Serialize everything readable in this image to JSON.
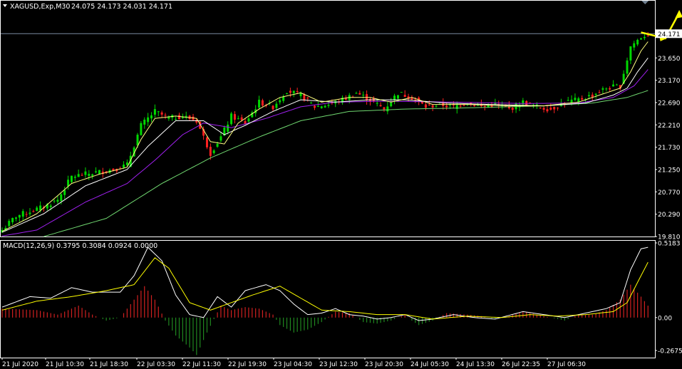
{
  "header": {
    "symbol": "XAGUSD,Exp,M30",
    "ohlc": "24.075 24.173 24.031 24.171"
  },
  "macd_header": "MACD(12,26,9) 0.3795 0.3084 0.0924 0.0000",
  "colors": {
    "background": "#000000",
    "frame": "#ffffff",
    "bull_candle": "#00d800",
    "bear_candle": "#ff2020",
    "ma_fast": "#ffff80",
    "ma_mid": "#ffffff",
    "ma_slow": "#a020f0",
    "ma_long": "#70d870",
    "macd_line": "#ffffff",
    "signal_line": "#ffff00",
    "hist_pos": "#d02020",
    "hist_neg": "#208820",
    "arrow": "#ffff00"
  },
  "chart_data": [
    {
      "type": "candlestick",
      "panel": "price",
      "ylim": [
        19.81,
        24.62
      ],
      "y_ticks": [
        "24.171",
        "23.650",
        "23.170",
        "22.690",
        "22.210",
        "21.730",
        "21.250",
        "20.770",
        "20.290",
        "19.810"
      ],
      "current_price": "24.171",
      "x_ticks": [
        "21 Jul 2020",
        "21 Jul 10:30",
        "21 Jul 18:30",
        "22 Jul 03:30",
        "22 Jul 11:30",
        "22 Jul 19:30",
        "23 Jul 04:30",
        "23 Jul 12:30",
        "23 Jul 20:30",
        "24 Jul 05:30",
        "24 Jul 13:30",
        "26 Jul 22:35",
        "27 Jul 06:30"
      ],
      "close_anchors": [
        [
          0,
          19.95
        ],
        [
          4,
          20.25
        ],
        [
          8,
          20.35
        ],
        [
          12,
          20.45
        ],
        [
          16,
          20.6
        ],
        [
          20,
          21.1
        ],
        [
          24,
          21.15
        ],
        [
          28,
          21.2
        ],
        [
          32,
          21.25
        ],
        [
          36,
          21.35
        ],
        [
          40,
          22.2
        ],
        [
          44,
          22.5
        ],
        [
          48,
          22.35
        ],
        [
          52,
          22.4
        ],
        [
          56,
          22.3
        ],
        [
          60,
          21.6
        ],
        [
          63,
          21.95
        ],
        [
          66,
          22.4
        ],
        [
          70,
          22.25
        ],
        [
          74,
          22.7
        ],
        [
          78,
          22.6
        ],
        [
          82,
          22.95
        ],
        [
          86,
          22.85
        ],
        [
          90,
          22.6
        ],
        [
          94,
          22.65
        ],
        [
          98,
          22.75
        ],
        [
          102,
          22.9
        ],
        [
          106,
          22.75
        ],
        [
          110,
          22.55
        ],
        [
          114,
          22.9
        ],
        [
          118,
          22.8
        ],
        [
          122,
          22.6
        ],
        [
          126,
          22.65
        ],
        [
          130,
          22.6
        ],
        [
          134,
          22.7
        ],
        [
          138,
          22.6
        ],
        [
          142,
          22.65
        ],
        [
          146,
          22.55
        ],
        [
          150,
          22.7
        ],
        [
          154,
          22.6
        ],
        [
          158,
          22.55
        ],
        [
          162,
          22.7
        ],
        [
          166,
          22.75
        ],
        [
          170,
          22.85
        ],
        [
          174,
          23.0
        ],
        [
          178,
          23.05
        ],
        [
          181,
          23.9
        ],
        [
          184,
          24.1
        ],
        [
          186,
          24.171
        ]
      ],
      "ma_fast_anchors": [
        [
          0,
          19.92
        ],
        [
          10,
          20.3
        ],
        [
          20,
          20.95
        ],
        [
          28,
          21.15
        ],
        [
          36,
          21.3
        ],
        [
          40,
          21.9
        ],
        [
          44,
          22.35
        ],
        [
          50,
          22.4
        ],
        [
          56,
          22.35
        ],
        [
          60,
          21.85
        ],
        [
          64,
          21.8
        ],
        [
          68,
          22.25
        ],
        [
          74,
          22.55
        ],
        [
          80,
          22.8
        ],
        [
          86,
          22.9
        ],
        [
          92,
          22.7
        ],
        [
          100,
          22.8
        ],
        [
          106,
          22.8
        ],
        [
          112,
          22.7
        ],
        [
          118,
          22.8
        ],
        [
          124,
          22.65
        ],
        [
          134,
          22.65
        ],
        [
          146,
          22.62
        ],
        [
          156,
          22.62
        ],
        [
          166,
          22.7
        ],
        [
          174,
          22.9
        ],
        [
          178,
          23.0
        ],
        [
          181,
          23.35
        ],
        [
          184,
          23.8
        ],
        [
          186,
          24.0
        ]
      ],
      "ma_mid_anchors": [
        [
          0,
          19.9
        ],
        [
          12,
          20.3
        ],
        [
          24,
          20.9
        ],
        [
          36,
          21.25
        ],
        [
          42,
          21.75
        ],
        [
          50,
          22.3
        ],
        [
          58,
          22.3
        ],
        [
          64,
          22.0
        ],
        [
          70,
          22.2
        ],
        [
          78,
          22.5
        ],
        [
          86,
          22.75
        ],
        [
          96,
          22.7
        ],
        [
          106,
          22.75
        ],
        [
          116,
          22.75
        ],
        [
          128,
          22.68
        ],
        [
          140,
          22.65
        ],
        [
          156,
          22.62
        ],
        [
          168,
          22.68
        ],
        [
          176,
          22.85
        ],
        [
          180,
          23.0
        ],
        [
          183,
          23.35
        ],
        [
          186,
          23.65
        ]
      ],
      "ma_slow_anchors": [
        [
          0,
          19.82
        ],
        [
          10,
          19.95
        ],
        [
          24,
          20.55
        ],
        [
          36,
          20.95
        ],
        [
          44,
          21.45
        ],
        [
          52,
          22.0
        ],
        [
          58,
          22.25
        ],
        [
          66,
          22.15
        ],
        [
          76,
          22.35
        ],
        [
          86,
          22.6
        ],
        [
          96,
          22.7
        ],
        [
          110,
          22.72
        ],
        [
          130,
          22.7
        ],
        [
          150,
          22.67
        ],
        [
          166,
          22.68
        ],
        [
          176,
          22.8
        ],
        [
          182,
          23.05
        ],
        [
          186,
          23.4
        ]
      ],
      "ma_long_anchors": [
        [
          12,
          19.81
        ],
        [
          30,
          20.2
        ],
        [
          46,
          20.95
        ],
        [
          60,
          21.5
        ],
        [
          74,
          21.95
        ],
        [
          86,
          22.3
        ],
        [
          100,
          22.5
        ],
        [
          116,
          22.55
        ],
        [
          136,
          22.58
        ],
        [
          156,
          22.62
        ],
        [
          170,
          22.68
        ],
        [
          180,
          22.8
        ],
        [
          186,
          22.95
        ]
      ],
      "candle_count": 187,
      "arrow_points_price": [
        [
          184,
          24.2
        ],
        [
          191,
          24.07
        ],
        [
          195,
          24.62
        ]
      ]
    },
    {
      "type": "macd",
      "panel": "indicator",
      "ylim": [
        -0.2675,
        0.5183
      ],
      "y_ticks": [
        "0.5183",
        "0.00",
        "-0.2675"
      ],
      "hist_anchors": [
        [
          0,
          0.06
        ],
        [
          10,
          0.05
        ],
        [
          16,
          0.02
        ],
        [
          20,
          0.06
        ],
        [
          22,
          0.08
        ],
        [
          26,
          0.02
        ],
        [
          30,
          -0.02
        ],
        [
          34,
          0.0
        ],
        [
          38,
          0.12
        ],
        [
          41,
          0.21
        ],
        [
          44,
          0.12
        ],
        [
          47,
          -0.02
        ],
        [
          50,
          -0.12
        ],
        [
          54,
          -0.2
        ],
        [
          56,
          -0.25
        ],
        [
          59,
          -0.1
        ],
        [
          63,
          0.08
        ],
        [
          66,
          0.05
        ],
        [
          70,
          0.07
        ],
        [
          74,
          0.06
        ],
        [
          78,
          0.02
        ],
        [
          80,
          -0.05
        ],
        [
          84,
          -0.1
        ],
        [
          88,
          -0.08
        ],
        [
          92,
          -0.03
        ],
        [
          96,
          0.04
        ],
        [
          100,
          0.03
        ],
        [
          104,
          -0.03
        ],
        [
          108,
          -0.04
        ],
        [
          112,
          -0.02
        ],
        [
          116,
          0.02
        ],
        [
          118,
          -0.02
        ],
        [
          120,
          -0.05
        ],
        [
          124,
          -0.02
        ],
        [
          128,
          0.03
        ],
        [
          134,
          0.02
        ],
        [
          138,
          0.01
        ],
        [
          142,
          -0.01
        ],
        [
          146,
          0.01
        ],
        [
          150,
          0.04
        ],
        [
          154,
          0.02
        ],
        [
          158,
          0.0
        ],
        [
          162,
          -0.02
        ],
        [
          166,
          0.02
        ],
        [
          170,
          0.02
        ],
        [
          174,
          0.05
        ],
        [
          178,
          0.12
        ],
        [
          181,
          0.22
        ],
        [
          184,
          0.14
        ],
        [
          186,
          0.08
        ]
      ],
      "macd_anchors": [
        [
          0,
          0.07
        ],
        [
          8,
          0.14
        ],
        [
          14,
          0.13
        ],
        [
          20,
          0.2
        ],
        [
          26,
          0.17
        ],
        [
          34,
          0.17
        ],
        [
          38,
          0.28
        ],
        [
          42,
          0.47
        ],
        [
          46,
          0.38
        ],
        [
          50,
          0.15
        ],
        [
          54,
          0.02
        ],
        [
          58,
          0.0
        ],
        [
          62,
          0.14
        ],
        [
          66,
          0.07
        ],
        [
          70,
          0.18
        ],
        [
          76,
          0.22
        ],
        [
          80,
          0.18
        ],
        [
          84,
          0.09
        ],
        [
          88,
          0.02
        ],
        [
          92,
          0.03
        ],
        [
          96,
          0.06
        ],
        [
          100,
          0.02
        ],
        [
          104,
          0.01
        ],
        [
          108,
          -0.01
        ],
        [
          112,
          0.0
        ],
        [
          116,
          0.02
        ],
        [
          120,
          -0.02
        ],
        [
          124,
          -0.01
        ],
        [
          130,
          0.02
        ],
        [
          136,
          0.0
        ],
        [
          142,
          -0.01
        ],
        [
          150,
          0.04
        ],
        [
          156,
          0.02
        ],
        [
          162,
          0.0
        ],
        [
          168,
          0.03
        ],
        [
          174,
          0.06
        ],
        [
          178,
          0.1
        ],
        [
          181,
          0.32
        ],
        [
          184,
          0.46
        ],
        [
          186,
          0.47
        ]
      ],
      "signal_anchors": [
        [
          0,
          0.05
        ],
        [
          10,
          0.11
        ],
        [
          20,
          0.14
        ],
        [
          30,
          0.18
        ],
        [
          38,
          0.22
        ],
        [
          44,
          0.4
        ],
        [
          48,
          0.33
        ],
        [
          54,
          0.1
        ],
        [
          60,
          0.05
        ],
        [
          66,
          0.1
        ],
        [
          72,
          0.15
        ],
        [
          80,
          0.21
        ],
        [
          86,
          0.13
        ],
        [
          92,
          0.05
        ],
        [
          100,
          0.04
        ],
        [
          108,
          0.02
        ],
        [
          116,
          0.02
        ],
        [
          124,
          -0.01
        ],
        [
          134,
          0.01
        ],
        [
          144,
          0.0
        ],
        [
          152,
          0.02
        ],
        [
          160,
          0.01
        ],
        [
          168,
          0.02
        ],
        [
          176,
          0.04
        ],
        [
          180,
          0.1
        ],
        [
          184,
          0.28
        ],
        [
          186,
          0.37
        ]
      ]
    }
  ]
}
